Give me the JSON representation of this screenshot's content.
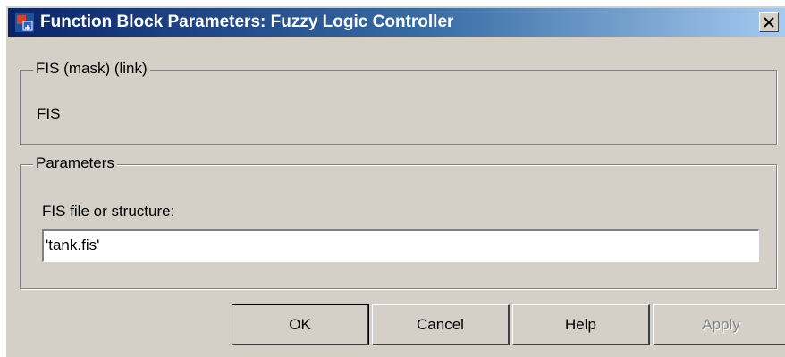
{
  "window": {
    "title": "Function Block Parameters: Fuzzy Logic Controller",
    "icon": "simulink-block-icon",
    "close_icon": "close-x-icon"
  },
  "mask_group": {
    "legend": "FIS (mask) (link)",
    "description": "FIS"
  },
  "params_group": {
    "legend": "Parameters",
    "field_label": "FIS file or structure:",
    "field_value": "'tank.fis'"
  },
  "buttons": {
    "ok": "OK",
    "cancel": "Cancel",
    "help": "Help",
    "apply": "Apply"
  },
  "colors": {
    "dialog_bg": "#d4d0c8",
    "titlebar_start": "#0a246a",
    "titlebar_end": "#a6caf0"
  }
}
